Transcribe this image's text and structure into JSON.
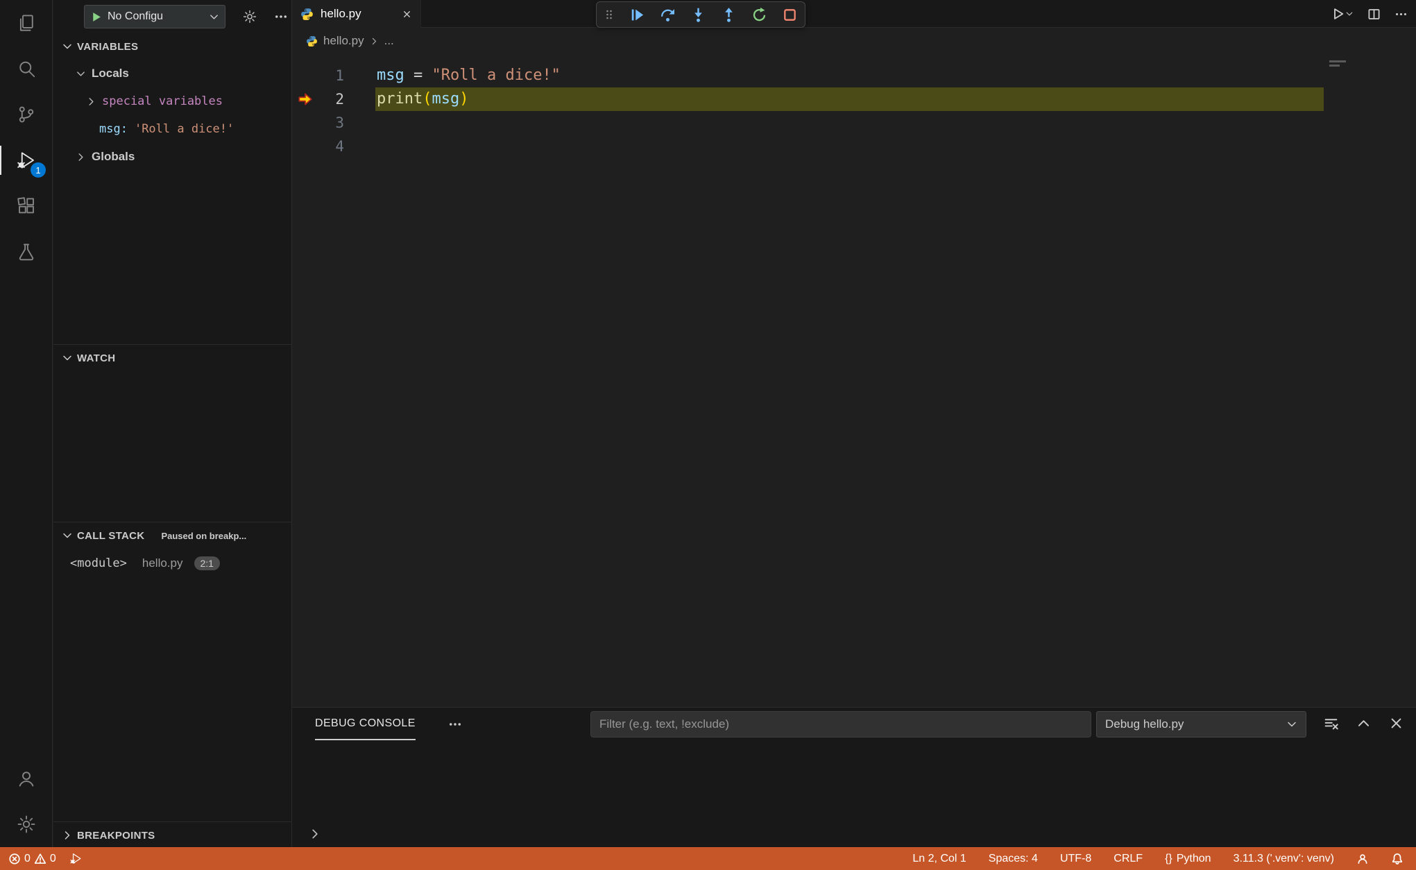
{
  "colors": {
    "accent": "#0078D4",
    "status_bg": "#C65627",
    "debug_blue": "#75BEFF",
    "debug_green": "#89D185",
    "debug_red": "#F48771",
    "bp_gold": "#FFCC00",
    "syn_var": "#9CDCFE",
    "syn_str": "#CE9178",
    "syn_fn": "#DCDCAA",
    "syn_brk": "#FFD700",
    "syn_fg": "#D4D4D4",
    "special_purple": "#C586C0",
    "line_hl": "rgba(255,255,0,0.20)"
  },
  "activity_bar": {
    "badge": "1",
    "items": [
      "explorer",
      "search",
      "source-control",
      "run-and-debug",
      "extensions",
      "testing"
    ],
    "bottom_items": [
      "accounts",
      "settings"
    ]
  },
  "sidebar": {
    "toolbar": {
      "config_label": "No Configu"
    },
    "variables": {
      "title": "VARIABLES",
      "groups": [
        {
          "label": "Locals"
        },
        {
          "label": "Globals"
        }
      ],
      "special_row": "special variables",
      "variable": {
        "name": "msg:",
        "value": "'Roll a dice!'"
      }
    },
    "watch": {
      "title": "WATCH"
    },
    "call_stack": {
      "title": "CALL STACK",
      "status": "Paused on breakp...",
      "frame": {
        "name": "<module>",
        "file": "hello.py",
        "position": "2:1"
      }
    },
    "breakpoints": {
      "title": "BREAKPOINTS"
    }
  },
  "editor": {
    "tab": {
      "label": "hello.py"
    },
    "breadcrumb": {
      "file": "hello.py",
      "more": "..."
    },
    "debug_toolbar_icons": [
      "drag-grip",
      "continue",
      "step-over",
      "step-into",
      "step-out",
      "restart",
      "stop"
    ],
    "code": {
      "lines": [
        {
          "num": "1",
          "tokens": {
            "a": "msg",
            "b": " = ",
            "c": "\"Roll a dice!\""
          }
        },
        {
          "num": "2",
          "tokens": {
            "a": "print",
            "b": "(",
            "c": "msg",
            "d": ")"
          }
        },
        {
          "num": "3"
        },
        {
          "num": "4"
        }
      ]
    }
  },
  "panel": {
    "tab": "DEBUG CONSOLE",
    "filter_placeholder": "Filter (e.g. text, !exclude)",
    "console_dropdown": "Debug hello.py"
  },
  "status_bar": {
    "error_count": "0",
    "warning_count": "0",
    "cursor": "Ln 2, Col 1",
    "indent": "Spaces: 4",
    "encoding": "UTF-8",
    "eol": "CRLF",
    "language_glyph": "{}",
    "language": "Python",
    "interpreter": "3.11.3 ('.venv': venv)"
  }
}
